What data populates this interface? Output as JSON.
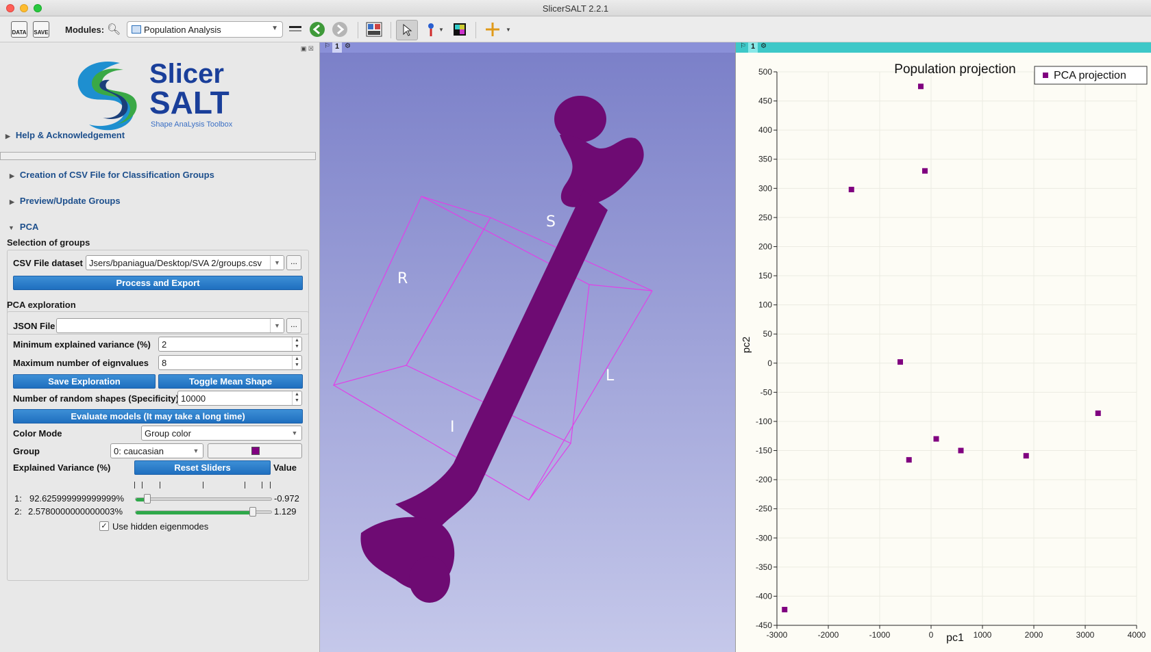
{
  "window": {
    "title": "SlicerSALT 2.2.1"
  },
  "toolbar": {
    "data_label": "DATA",
    "save_label": "SAVE",
    "modules_label": "Modules:",
    "module_selected": "Population Analysis"
  },
  "logo": {
    "line1": "Slicer",
    "line2": "SALT",
    "tagline": "Shape AnaLysis Toolbox"
  },
  "sections": {
    "help": "Help & Acknowledgement",
    "csv_creation": "Creation of CSV File for Classification Groups",
    "preview": "Preview/Update Groups",
    "pca": "PCA"
  },
  "selection": {
    "title": "Selection of groups",
    "csv_label": "CSV File dataset",
    "csv_value": "Jsers/bpaniagua/Desktop/SVA 2/groups.csv",
    "browse": "...",
    "process_button": "Process and Export"
  },
  "exploration": {
    "title": "PCA exploration",
    "json_label": "JSON File",
    "json_value": "",
    "browse": "...",
    "min_var_label": "Minimum explained variance (%)",
    "min_var_value": "2",
    "max_eig_label": "Maximum number of eignvalues",
    "max_eig_value": "8",
    "save_button": "Save Exploration",
    "toggle_button": "Toggle Mean Shape",
    "random_label": "Number of random shapes (Specificity)",
    "random_value": "10000",
    "evaluate_button": "Evaluate models (It may take a long time)",
    "color_mode_label": "Color Mode",
    "color_mode_value": "Group color",
    "group_label": "Group",
    "group_value": "0: caucasian",
    "group_color": "#800080",
    "variance_label": "Explained Variance (%)",
    "reset_button": "Reset Sliders",
    "value_label": "Value",
    "sliders": [
      {
        "index": "1:",
        "variance": "92.625999999999999%",
        "value": "-0.972",
        "level": 0.09
      },
      {
        "index": "2:",
        "variance": "2.5780000000000003%",
        "value": "1.129",
        "level": 0.86
      }
    ],
    "hidden_label": "Use hidden eigenmodes",
    "hidden_checked": true
  },
  "view3d": {
    "view_number": "1",
    "orientation": {
      "s": "S",
      "r": "R",
      "l": "L",
      "i": "I"
    },
    "bone_color": "#6e0b73",
    "box_color": "#e040e8"
  },
  "chart_view": {
    "view_number": "1"
  },
  "chart_data": {
    "type": "scatter",
    "title": "Population projection",
    "xlabel": "pc1",
    "ylabel": "pc2",
    "xlim": [
      -3000,
      4000
    ],
    "ylim": [
      -450,
      500
    ],
    "xticks": [
      -3000,
      -2000,
      -1000,
      0,
      1000,
      2000,
      3000,
      4000
    ],
    "yticks": [
      500,
      450,
      400,
      350,
      300,
      250,
      200,
      150,
      100,
      50,
      0,
      -50,
      -100,
      -150,
      -200,
      -250,
      -300,
      -350,
      -400,
      -450
    ],
    "legend": "top-right",
    "grid": true,
    "color": "#800080",
    "series": [
      {
        "name": "PCA projection",
        "points": [
          {
            "x": -200,
            "y": 475
          },
          {
            "x": -120,
            "y": 330
          },
          {
            "x": -1550,
            "y": 298
          },
          {
            "x": -600,
            "y": 2
          },
          {
            "x": 3250,
            "y": -86
          },
          {
            "x": 100,
            "y": -130
          },
          {
            "x": 580,
            "y": -150
          },
          {
            "x": -430,
            "y": -166
          },
          {
            "x": 1850,
            "y": -159
          },
          {
            "x": -2850,
            "y": -423
          }
        ]
      }
    ]
  }
}
